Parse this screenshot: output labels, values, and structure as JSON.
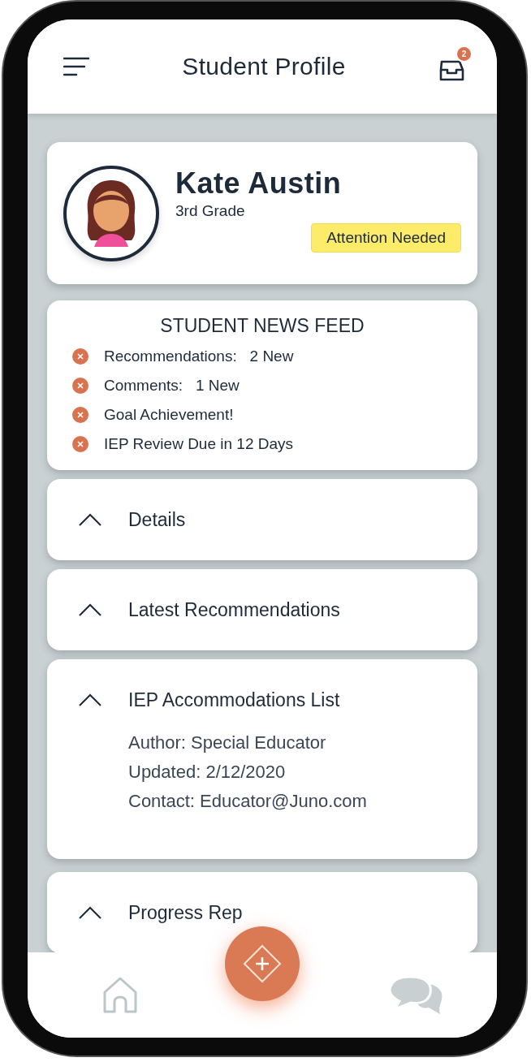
{
  "header": {
    "title": "Student Profile",
    "inbox_badge": "2"
  },
  "profile": {
    "name": "Kate Austin",
    "grade": "3rd Grade",
    "status": "Attention Needed"
  },
  "news_feed": {
    "title": "STUDENT NEWS FEED",
    "items": [
      {
        "label": "Recommendations:",
        "value": "2 New"
      },
      {
        "label": "Comments:",
        "value": "1 New"
      },
      {
        "label": "Goal Achievement!"
      },
      {
        "label": "IEP Review Due in 12 Days"
      }
    ]
  },
  "sections": [
    {
      "title": "Details"
    },
    {
      "title": "Latest Recommendations"
    },
    {
      "title": "IEP Accommodations List",
      "lines": [
        "Author: Special Educator",
        "Updated: 2/12/2020",
        "Contact: Educator@Juno.com"
      ]
    },
    {
      "title": "Progress Rep"
    }
  ]
}
